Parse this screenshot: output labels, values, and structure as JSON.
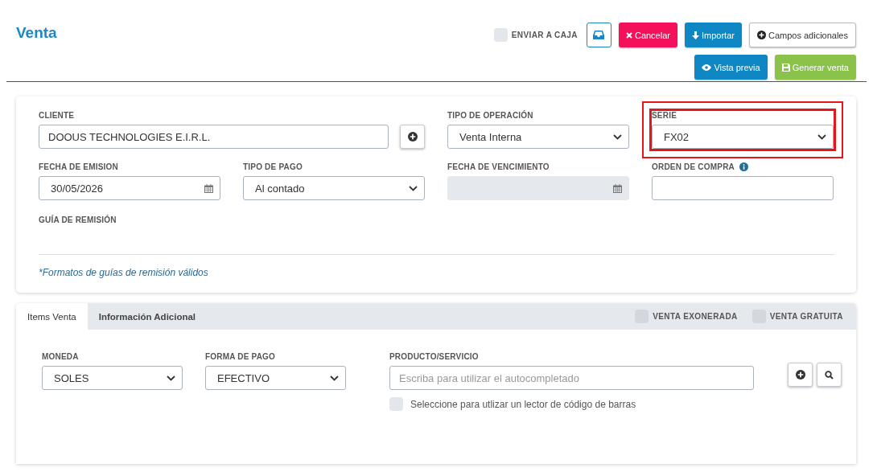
{
  "title": "Venta",
  "header": {
    "send_to_cashier": {
      "label": "ENVIAR A CAJA",
      "checked": false
    },
    "buttons": [
      {
        "kind": "inbox"
      },
      {
        "kind": "cancel",
        "label": "Cancelar"
      },
      {
        "kind": "import",
        "label": "Importar"
      },
      {
        "kind": "extra",
        "label": "Campos adicionales"
      },
      {
        "kind": "preview",
        "label": "Vista previa"
      },
      {
        "kind": "generate",
        "label": "Generar venta"
      }
    ]
  },
  "form": {
    "fields": [
      {
        "kind": "client",
        "label": "CLIENTE",
        "value": "DOOUS TECHNOLOGIES E.I.R.L."
      },
      {
        "kind": "select",
        "label": "TIPO DE OPERACIÓN",
        "value": "Venta Interna",
        "highlighted": false
      },
      {
        "kind": "select",
        "label": "SERIE",
        "value": "FX02",
        "highlighted": true
      },
      {
        "kind": "date",
        "label": "FECHA DE EMISION",
        "value": "30/05/2026",
        "disabled": false
      },
      {
        "kind": "select",
        "label": "TIPO DE PAGO",
        "value": "Al contado",
        "highlighted": false
      },
      {
        "kind": "date",
        "label": "FECHA DE VENCIMIENTO",
        "disabled": true
      },
      {
        "kind": "info",
        "label": "ORDEN DE COMPRA"
      }
    ],
    "remission_label": "GUÍA DE REMISIÓN",
    "remission_note": "*Formatos de guías de remisión válidos"
  },
  "items": {
    "tabs": [
      {
        "label": "Items Venta",
        "selected": true
      },
      {
        "label": "Información Adicional",
        "selected": false
      }
    ],
    "toggles": [
      {
        "label": "VENTA EXONERADA",
        "checked": false
      },
      {
        "label": "VENTA GRATUITA",
        "checked": false
      }
    ],
    "currency": {
      "label": "MONEDA",
      "value": "SOLES"
    },
    "payment": {
      "label": "FORMA DE PAGO",
      "value": "EFECTIVO"
    },
    "product": {
      "label": "PRODUCTO/SERVICIO",
      "placeholder": "Escriba para utilizar el autocompletado"
    },
    "barcode": {
      "label": "Seleccione para utlizar un lector de código de barras",
      "checked": false
    }
  }
}
